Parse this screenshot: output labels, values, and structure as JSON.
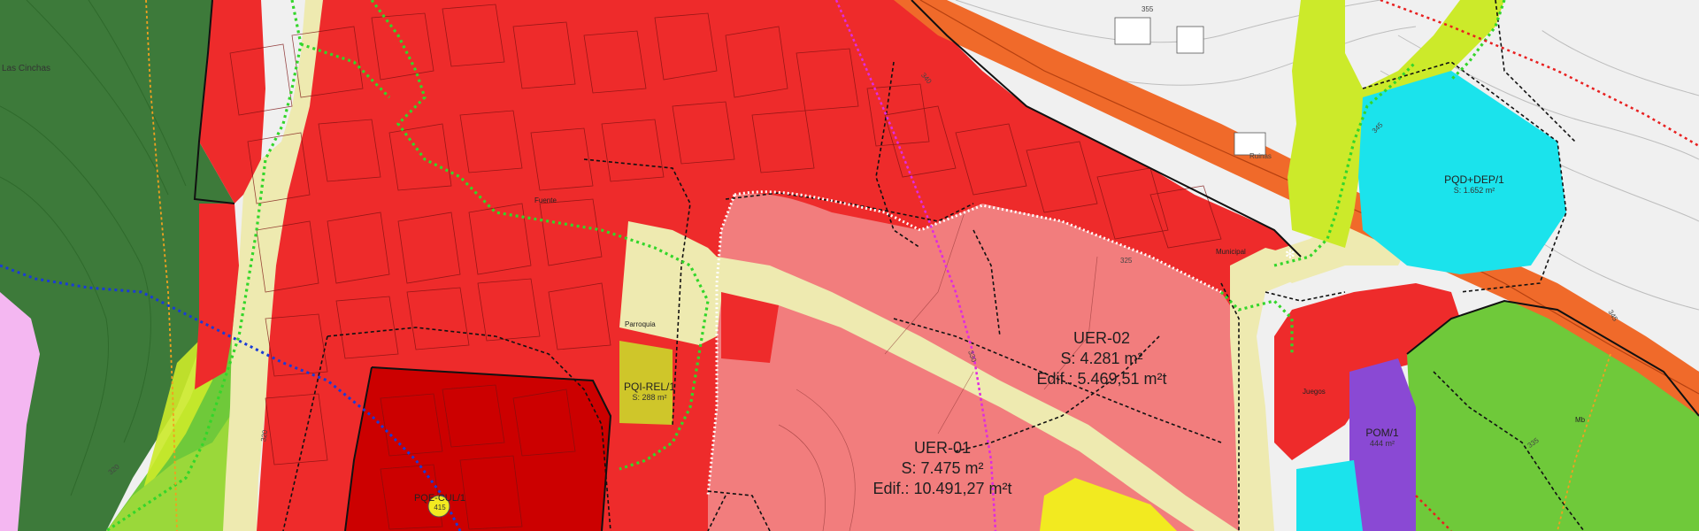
{
  "map": {
    "place_names": {
      "las_cinchas": "Las Cinchas",
      "ruinas": "Ruinas",
      "fuente": "Fuente",
      "parroquia": "Parroquia",
      "municipal": "Municipal",
      "juegos": "Juegos",
      "mb": "Mb"
    },
    "zones": {
      "uer02": {
        "name": "UER-02",
        "surface": "S: 4.281 m²",
        "edif": "Edif.: 5.469,51 m²t"
      },
      "uer01": {
        "name": "UER-01",
        "surface": "S: 7.475 m²",
        "edif": "Edif.: 10.491,27 m²t"
      },
      "pqd_dep1": {
        "name": "PQD+DEP/1",
        "surface": "S: 1.652 m²"
      },
      "pqi_rel1": {
        "name": "PQI-REL/1",
        "surface": "S: 288 m²"
      },
      "pom1": {
        "name": "POM/1",
        "surface": "444 m²"
      },
      "pqe_cul1": {
        "name": "PQE-CUL/1",
        "surface": "415"
      }
    },
    "contours": {
      "c355": "355",
      "c345": "345",
      "c345b": "345",
      "c320": "320",
      "c320b": "320",
      "c335": "335",
      "c340": "340",
      "c330": "330",
      "c325": "325"
    },
    "colors": {
      "urban_red": "#ee2b2b",
      "urban_pink": "#f27d7d",
      "dark_red": "#cc0000",
      "green_dark": "#3d7a3a",
      "green_light": "#6fc93a",
      "lime": "#ccea2a",
      "street_beige": "#eeeab0",
      "cyan": "#1be3ec",
      "purple": "#8a49d4",
      "yellow": "#f2ea20",
      "road_orange": "#f06a2a"
    }
  }
}
